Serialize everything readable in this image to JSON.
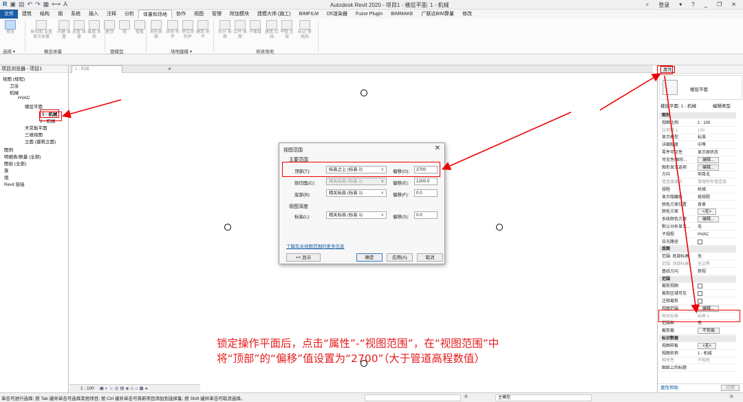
{
  "titlebar": {
    "title": "Autodesk Revit 2020 - 项目1 - 楼层平面: 1 - 机械",
    "search_label": "登录",
    "help_label": "?"
  },
  "menu": [
    "文件",
    "建筑",
    "结构",
    "钢",
    "系统",
    "插入",
    "注释",
    "分析",
    "体量和场地",
    "协作",
    "视图",
    "管理",
    "附加模块",
    "建模大师 (施工)",
    "BIMFILM",
    "D5渲染器",
    "Fuzor Plugin",
    "BIMMAKE",
    "广联达BIM算量",
    "修改"
  ],
  "ribbon": {
    "buttons": [
      "修改",
      "按视图 设置显示体量",
      "内建 体量",
      "放置 体量",
      "幕墙 系统",
      "屋顶",
      "墙",
      "楼板",
      "地形表面",
      "场地 构件",
      "停车场 构件",
      "建筑 地坪",
      "拆分 表面",
      "合并 表面",
      "子面域",
      "建筑 红线",
      "平整 区域",
      "标记 等高线"
    ],
    "panels": [
      "选择 ▾",
      "概念体量",
      "面模型",
      "场地建模 ▾",
      "修改场地"
    ]
  },
  "browser": {
    "title": "项目浏览器 - 项目1",
    "items": [
      "视图 (规程)",
      "卫浴",
      "机械",
      "HVAC",
      "楼层平面",
      "1 - 机械",
      "2 - 机械",
      "天花板平面",
      "三维视图",
      "立面 (建筑立面)",
      "图例",
      "明细表/数量 (全部)",
      "图纸 (全部)",
      "族",
      "组",
      "Revit 链接"
    ]
  },
  "view_tab": "1 - 机械",
  "view_control": "1 : 100",
  "dialog": {
    "title": "视图范围",
    "primary_section": "主要范围",
    "rows": [
      {
        "label": "顶部(T):",
        "level": "标高之上 (标高 2)",
        "offset_label": "偏移(O):",
        "offset": "2700"
      },
      {
        "label": "剖切面(C):",
        "level": "相关标高 (标高 1)",
        "offset_label": "偏移(E):",
        "offset": "1200.0"
      },
      {
        "label": "底部(B):",
        "level": "相关标高 (标高 1)",
        "offset_label": "偏移(F):",
        "offset": "0.0"
      }
    ],
    "depth_section": "视图深度",
    "depth_row": {
      "label": "标高(L):",
      "level": "相关标高 (标高 1)",
      "offset_label": "偏移(S):",
      "offset": "0.0"
    },
    "link": "了解有关视图范围的更多信息",
    "show_btn": "<< 显示",
    "ok_btn": "确定",
    "apply_btn": "应用(A)",
    "cancel_btn": "取消"
  },
  "properties": {
    "tab": "属性",
    "type_name": "楼层平面",
    "type_selector": "楼层平面: 1 - 机械",
    "edit_type": "编辑类型",
    "rows": [
      {
        "k": "图形",
        "v": "",
        "cat": true
      },
      {
        "k": "视图比例",
        "v": "1 : 100"
      },
      {
        "k": "比例值 1:",
        "v": "100",
        "gray": true
      },
      {
        "k": "显示模型",
        "v": "标准"
      },
      {
        "k": "详细程度",
        "v": "中等"
      },
      {
        "k": "零件可见性",
        "v": "显示原状态"
      },
      {
        "k": "可见性/图形...",
        "v": "编辑...",
        "btn": true
      },
      {
        "k": "图形显示选项",
        "v": "编辑...",
        "btn": true
      },
      {
        "k": "方向",
        "v": "项目北"
      },
      {
        "k": "墙连接显示",
        "v": "清理所有墙连接",
        "gray": true
      },
      {
        "k": "规程",
        "v": "机械"
      },
      {
        "k": "显示隐藏线",
        "v": "按规程"
      },
      {
        "k": "颜色方案位置",
        "v": "背景"
      },
      {
        "k": "颜色方案",
        "v": "<无>",
        "btn": true
      },
      {
        "k": "系统颜色方案",
        "v": "编辑...",
        "btn": true
      },
      {
        "k": "默认分析显示...",
        "v": "无"
      },
      {
        "k": "子规程",
        "v": "HVAC"
      },
      {
        "k": "日光路径",
        "v": "",
        "chk": true
      },
      {
        "k": "底图",
        "v": "",
        "cat": true
      },
      {
        "k": "范围: 底部标高",
        "v": "无"
      },
      {
        "k": "范围: 顶部标高",
        "v": "无边界",
        "gray": true
      },
      {
        "k": "基线方向",
        "v": "俯视"
      },
      {
        "k": "范围",
        "v": "",
        "cat": true
      },
      {
        "k": "裁剪视图",
        "v": "",
        "chk": true
      },
      {
        "k": "裁剪区域可见",
        "v": "",
        "chk": true
      },
      {
        "k": "注释裁剪",
        "v": "",
        "chk": true
      },
      {
        "k": "视图范围",
        "v": "编辑...",
        "btn": true
      },
      {
        "k": "相关标高",
        "v": "标高 1",
        "gray": true
      },
      {
        "k": "范围框",
        "v": "无"
      },
      {
        "k": "截剪裁",
        "v": "不剪裁",
        "btn": true
      },
      {
        "k": "标识数据",
        "v": "",
        "cat": true
      },
      {
        "k": "视图样板",
        "v": "<无>",
        "btn": true
      },
      {
        "k": "视图名称",
        "v": "1 - 机械"
      },
      {
        "k": "相关性",
        "v": "不相关",
        "gray": true
      },
      {
        "k": "图纸上的标题",
        "v": ""
      }
    ],
    "help_link": "属性帮助",
    "apply_btn": "应用"
  },
  "status": {
    "message": "单击可进行选择; 按 Tab 键并单击可选择其他项目; 按 Ctrl 键并单击可将新项目添加到选择集; 按 Shift 键并单击可取消选择。",
    "model_label": "主模型",
    "zero": ":0"
  },
  "caption": {
    "line1": "锁定操作平面后，点击“属性”-“视图范围”，在“视图范围”中",
    "line2": "将“顶部”的“偏移”值设置为“2700”（大于管道高程数值）"
  },
  "colors": {
    "annotation": "#e00000",
    "file_tab": "#1a5ea8"
  }
}
